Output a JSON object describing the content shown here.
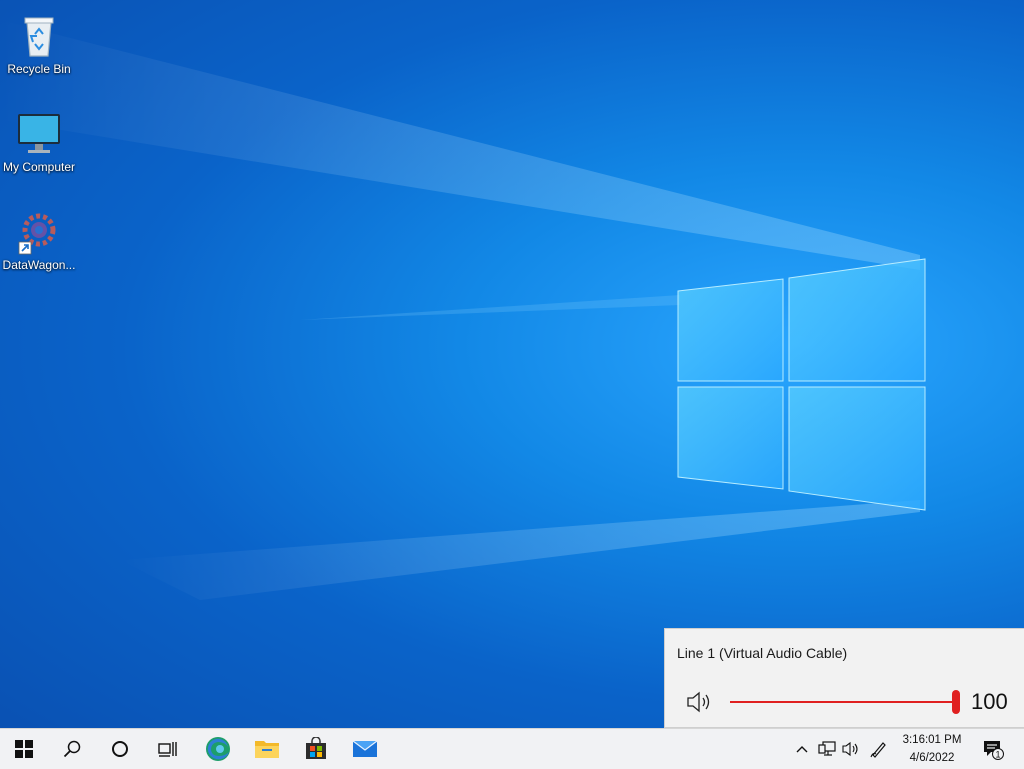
{
  "desktop": {
    "icons": [
      {
        "label": "Recycle Bin",
        "icon": "recycle-bin-icon"
      },
      {
        "label": "My Computer",
        "icon": "computer-icon"
      },
      {
        "label": "DataWagon...",
        "icon": "datawagon-icon"
      }
    ]
  },
  "volume_flyout": {
    "device_name": "Line 1 (Virtual Audio Cable)",
    "volume": "100",
    "volume_fraction": 1.0,
    "accent_color": "#e02020"
  },
  "taskbar": {
    "buttons": [
      "start-icon",
      "search-icon",
      "cortana-icon",
      "task-view-icon",
      "edge-icon",
      "file-explorer-icon",
      "store-icon",
      "mail-icon"
    ],
    "tray_icons": [
      "chevron-up-icon",
      "network-icon",
      "speaker-icon",
      "pen-icon"
    ],
    "clock_time": "3:16:01 PM",
    "clock_date": "4/6/2022",
    "notification_count": "1"
  }
}
